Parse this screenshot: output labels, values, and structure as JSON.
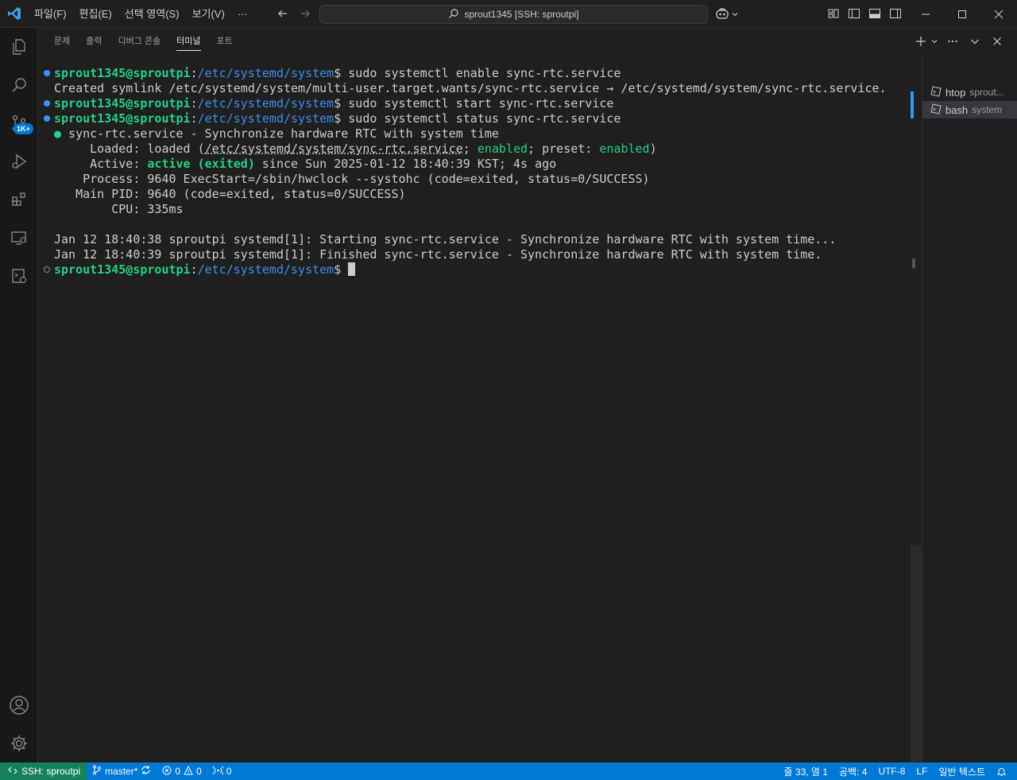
{
  "titlebar": {
    "menu": [
      "파일(F)",
      "편집(E)",
      "선택 영역(S)",
      "보기(V)",
      "···"
    ],
    "search_text": "sprout1345 [SSH: sproutpi]"
  },
  "activity": {
    "badge": "1K+"
  },
  "panel": {
    "tabs": [
      "문제",
      "출력",
      "디버그 콘솔",
      "터미널",
      "포트"
    ],
    "active_tab": "터미널"
  },
  "terminal": {
    "prompt_user": "sprout1345@sproutpi",
    "prompt_path": "/etc/systemd/system",
    "cmd1": "sudo systemctl enable sync-rtc.service",
    "symlink_line": "Created symlink /etc/systemd/system/multi-user.target.wants/sync-rtc.service → /etc/systemd/system/sync-rtc.service.",
    "cmd2": "sudo systemctl start sync-rtc.service",
    "cmd3": "sudo systemctl status sync-rtc.service",
    "status_header": "sync-rtc.service - Synchronize hardware RTC with system time",
    "loaded_label": "     Loaded: ",
    "loaded_state": "loaded (",
    "loaded_path": "/etc/systemd/system/sync-rtc.service",
    "loaded_sep": "; ",
    "loaded_enabled": "enabled",
    "loaded_preset": "; preset: ",
    "loaded_preset_val": "enabled",
    "loaded_close": ")",
    "active_label": "     Active: ",
    "active_state": "active (exited)",
    "active_since": " since Sun 2025-01-12 18:40:39 KST; 4s ago",
    "process_line": "    Process: 9640 ExecStart=/sbin/hwclock --systohc (code=exited, status=0/SUCCESS)",
    "mainpid_line": "   Main PID: 9640 (code=exited, status=0/SUCCESS)",
    "cpu_line": "        CPU: 335ms",
    "log1": "Jan 12 18:40:38 sproutpi systemd[1]: Starting sync-rtc.service - Synchronize hardware RTC with system time...",
    "log2": "Jan 12 18:40:39 sproutpi systemd[1]: Finished sync-rtc.service - Synchronize hardware RTC with system time."
  },
  "terminal_list": [
    {
      "name": "htop",
      "desc": "sprout..."
    },
    {
      "name": "bash",
      "desc": "system"
    }
  ],
  "statusbar": {
    "remote": "SSH: sproutpi",
    "branch": "master*",
    "errors": "0",
    "warnings": "0",
    "ports": "0",
    "position": "줄 33, 열 1",
    "spaces": "공백: 4",
    "encoding": "UTF-8",
    "eol": "LF",
    "language": "일반 텍스트"
  },
  "colors": {
    "accent": "#0078d4",
    "remote": "#16825d",
    "prompt_green": "#23d18b",
    "prompt_blue": "#3b8eea"
  }
}
